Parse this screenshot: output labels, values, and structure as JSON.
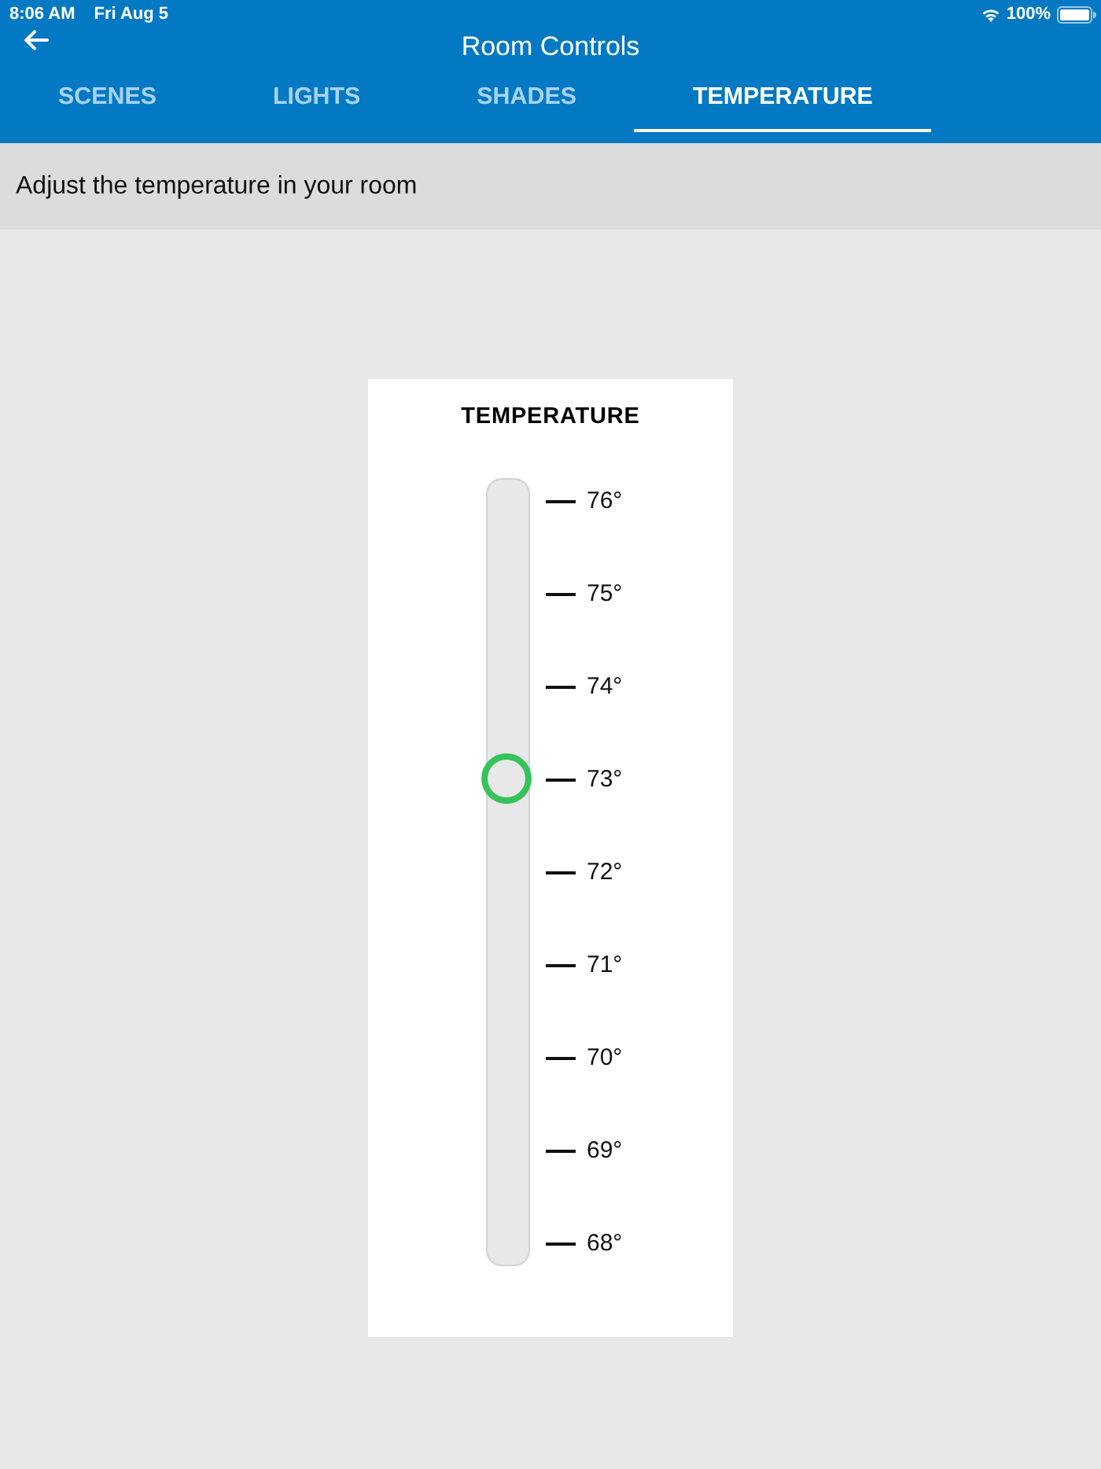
{
  "status_bar": {
    "time": "8:06 AM",
    "date": "Fri Aug 5",
    "battery": "100%"
  },
  "header": {
    "title": "Room Controls"
  },
  "tabs": [
    {
      "label": "SCENES",
      "selected": false
    },
    {
      "label": "LIGHTS",
      "selected": false
    },
    {
      "label": "SHADES",
      "selected": false
    },
    {
      "label": "TEMPERATURE",
      "selected": true
    }
  ],
  "instruction": "Adjust the temperature in your room",
  "temperature_card": {
    "title": "TEMPERATURE",
    "slider": {
      "level": 0.625
    },
    "scale": [
      "76°",
      "75°",
      "74°",
      "73°",
      "72°",
      "71°",
      "70°",
      "69°",
      "68°"
    ]
  }
}
